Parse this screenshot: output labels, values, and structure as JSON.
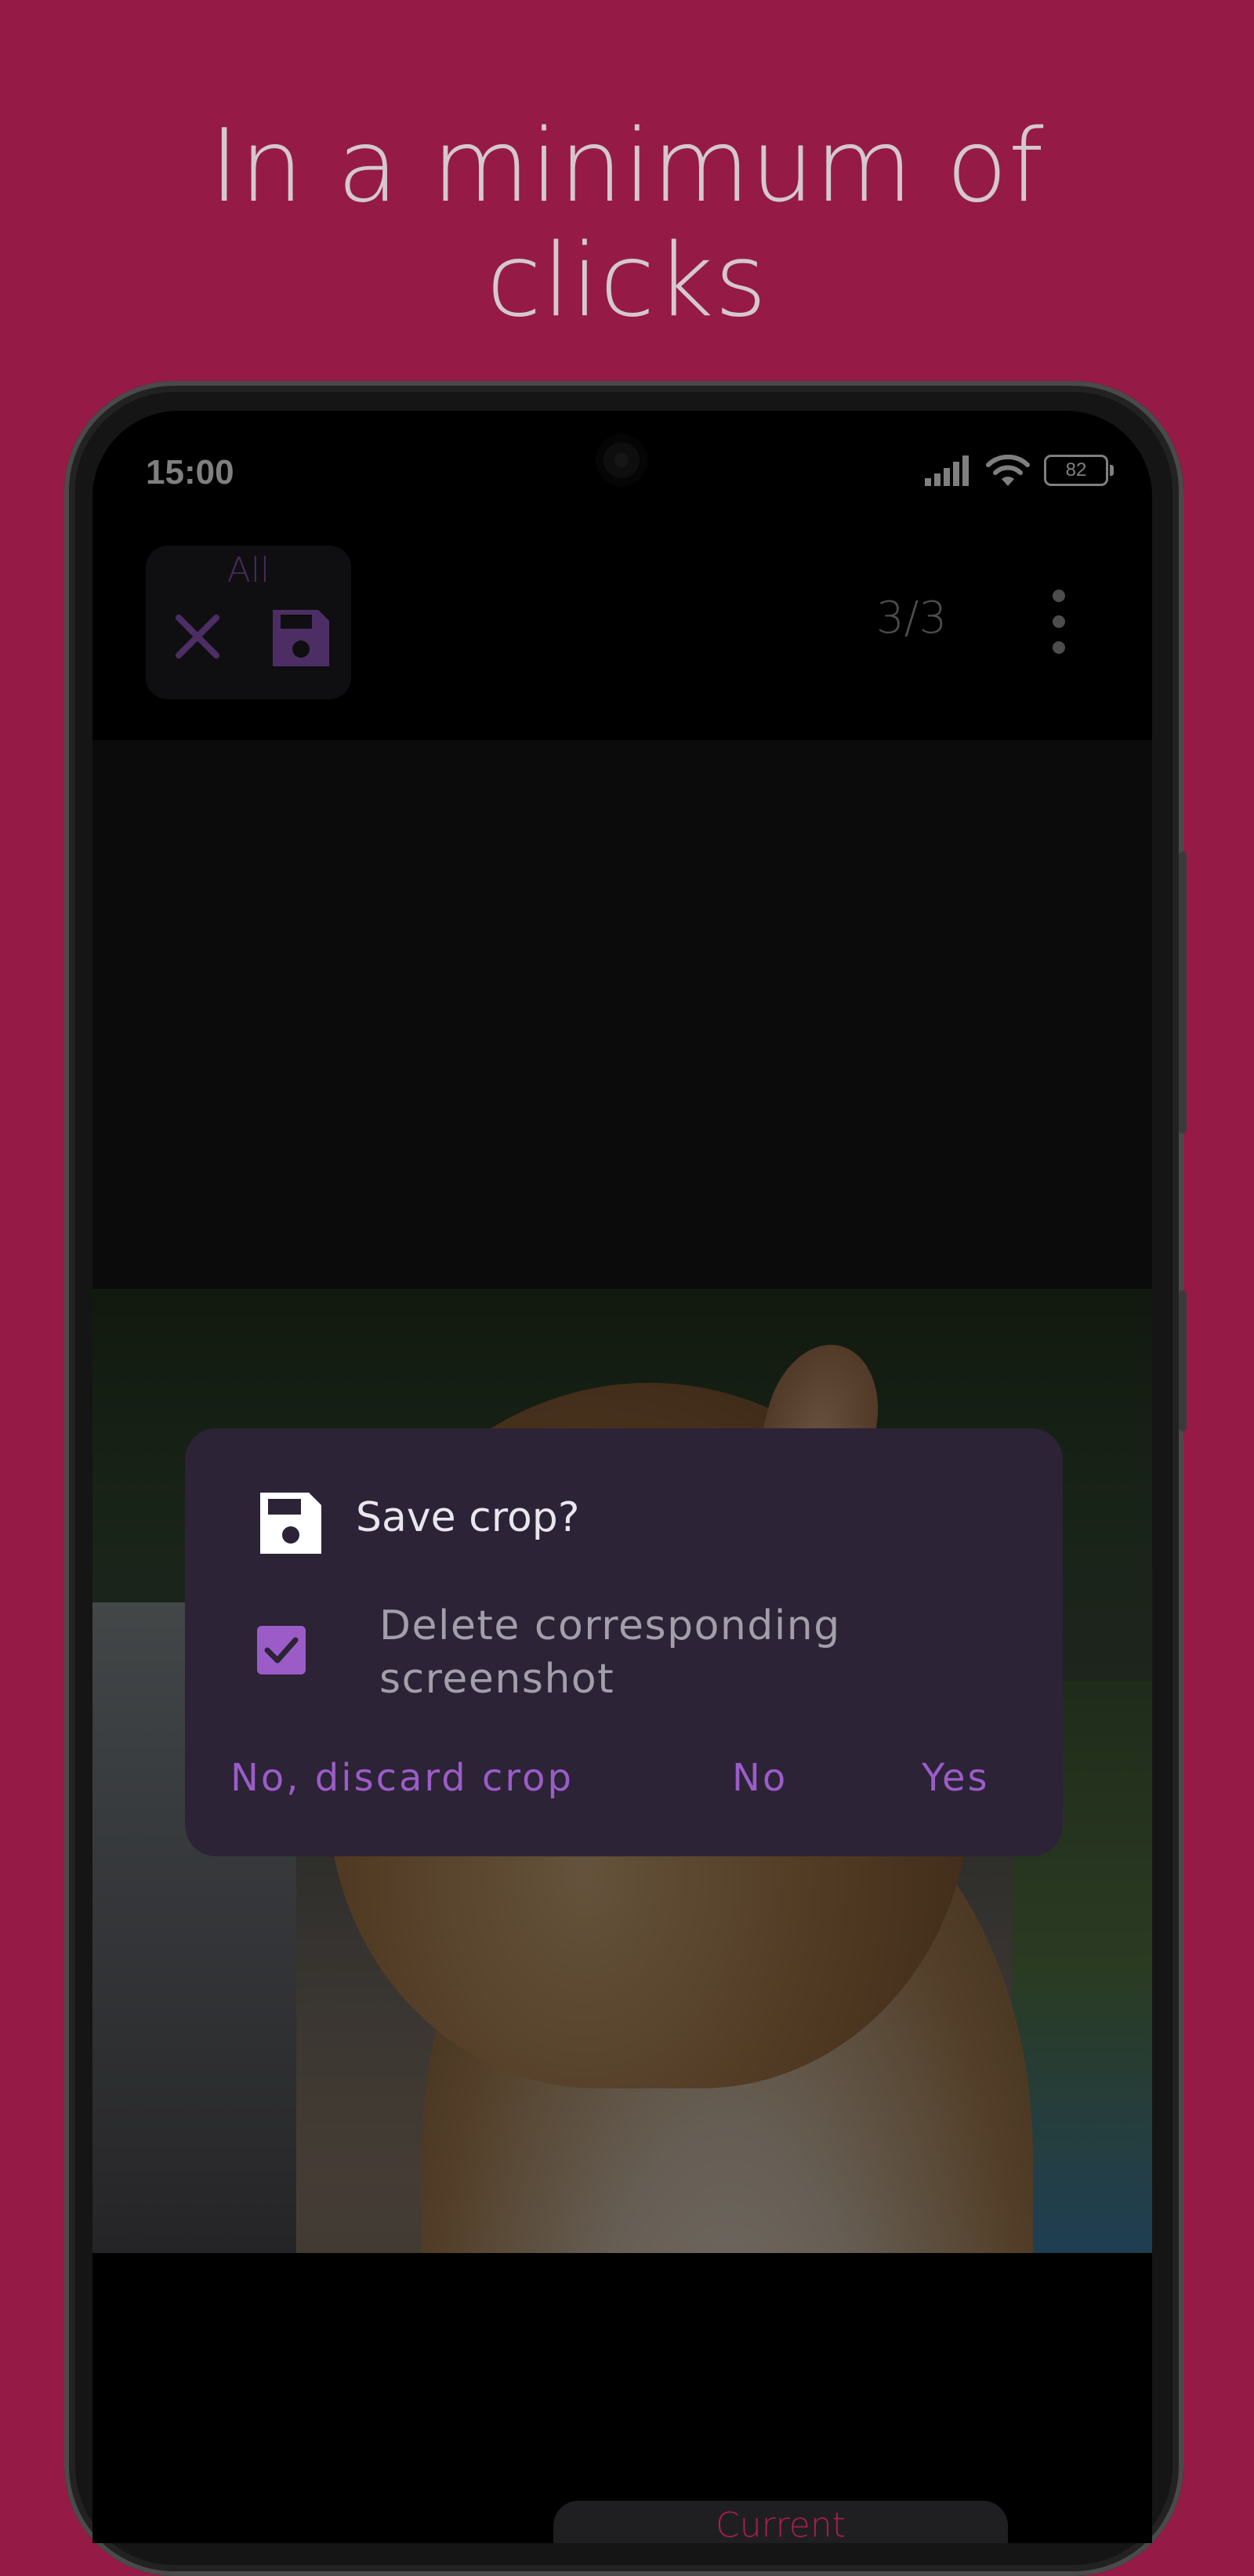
{
  "headline": {
    "line1": "In a minimum of",
    "line2": "clicks"
  },
  "status_bar": {
    "time": "15:00",
    "battery": "82",
    "icons": [
      "signal-icon",
      "wifi-icon",
      "battery-icon"
    ]
  },
  "toolbar": {
    "group_label": "All",
    "close_icon": "close-icon",
    "save_icon": "save-icon",
    "page_counter": "3/3",
    "menu_icon": "more-vert-icon"
  },
  "dialog": {
    "title": "Save crop?",
    "icon": "save-icon",
    "checkbox_label": "Delete corresponding screenshot",
    "checkbox_checked": true,
    "buttons": {
      "discard": "No, discard crop",
      "no": "No",
      "yes": "Yes"
    }
  },
  "bottom": {
    "chip_label": "Current"
  },
  "colors": {
    "background": "#961a46",
    "accent": "#9b5cc8",
    "dialog_bg": "#2c2336",
    "chip_text": "#a71f4d"
  }
}
